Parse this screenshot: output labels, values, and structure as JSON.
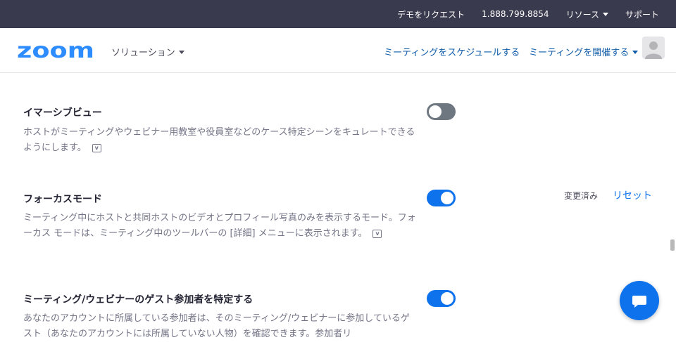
{
  "topbar": {
    "request_demo": "デモをリクエスト",
    "phone": "1.888.799.8854",
    "resources": "リソース",
    "support": "サポート"
  },
  "header": {
    "logo_text": "zoom",
    "solutions": "ソリューション",
    "schedule": "ミーティングをスケジュールする",
    "host": "ミーティングを開催する"
  },
  "settings": [
    {
      "title": "イマーシブビュー",
      "description": "ホストがミーティングやウェビナー用教室や役員室などのケース特定シーンをキュレートできるようにします。",
      "badge": "v",
      "enabled": false
    },
    {
      "title": "フォーカスモード",
      "description": "ミーティング中にホストと共同ホストのビデオとプロフィール写真のみを表示するモード。フォーカス モードは、ミーティング中のツールバーの [詳細] メニューに表示されます。",
      "badge": "v",
      "enabled": true,
      "changed_label": "変更済み",
      "reset_label": "リセット"
    },
    {
      "title": "ミーティング/ウェビナーのゲスト参加者を特定する",
      "description": "あなたのアカウントに所属している参加者は、そのミーティング/ウェビナーに参加しているゲスト（あなたのアカウントには所属していない人物）を確認できます。参加者リ",
      "enabled": true
    }
  ],
  "colors": {
    "topbar_bg": "#3a3a4e",
    "accent": "#0e72ed",
    "link": "#0e5ba8",
    "toggle_off": "#6e7680"
  },
  "icons": {
    "chat": "chat-bubble-icon",
    "avatar": "user-avatar-icon"
  }
}
